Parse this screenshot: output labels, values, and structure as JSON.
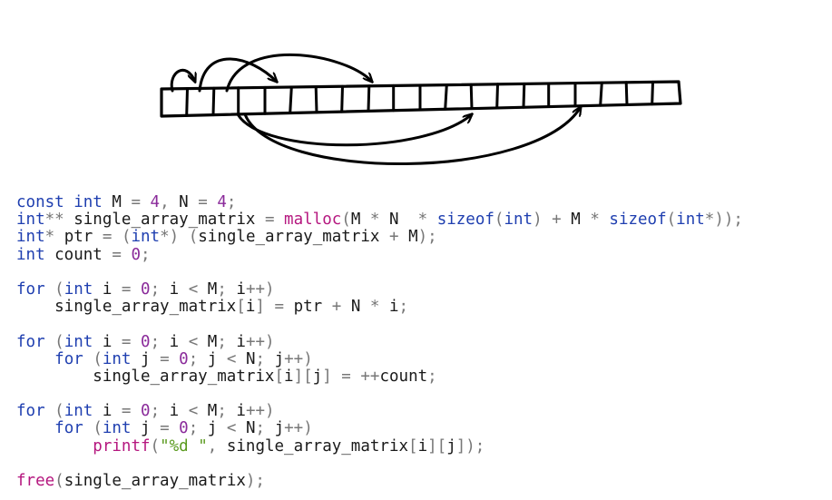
{
  "diagram": {
    "cell_count": 20,
    "pointer_cells": 4
  },
  "code_lines": [
    [
      [
        "kw",
        "const int"
      ],
      [
        "id",
        " M "
      ],
      [
        "op",
        "="
      ],
      [
        "id",
        " "
      ],
      [
        "num",
        "4"
      ],
      [
        "op",
        ","
      ],
      [
        "id",
        " N "
      ],
      [
        "op",
        "="
      ],
      [
        "id",
        " "
      ],
      [
        "num",
        "4"
      ],
      [
        "op",
        ";"
      ]
    ],
    [
      [
        "kw",
        "int"
      ],
      [
        "op",
        "**"
      ],
      [
        "id",
        " single_array_matrix "
      ],
      [
        "op",
        "="
      ],
      [
        "id",
        " "
      ],
      [
        "fn",
        "malloc"
      ],
      [
        "op",
        "("
      ],
      [
        "id",
        "M "
      ],
      [
        "op",
        "*"
      ],
      [
        "id",
        " N  "
      ],
      [
        "op",
        "*"
      ],
      [
        "id",
        " "
      ],
      [
        "kw",
        "sizeof"
      ],
      [
        "op",
        "("
      ],
      [
        "kw",
        "int"
      ],
      [
        "op",
        ")"
      ],
      [
        "id",
        " "
      ],
      [
        "op",
        "+"
      ],
      [
        "id",
        " M "
      ],
      [
        "op",
        "*"
      ],
      [
        "id",
        " "
      ],
      [
        "kw",
        "sizeof"
      ],
      [
        "op",
        "("
      ],
      [
        "kw",
        "int"
      ],
      [
        "op",
        "*"
      ],
      [
        "op",
        "));"
      ]
    ],
    [
      [
        "kw",
        "int"
      ],
      [
        "op",
        "*"
      ],
      [
        "id",
        " ptr "
      ],
      [
        "op",
        "="
      ],
      [
        "id",
        " "
      ],
      [
        "op",
        "("
      ],
      [
        "kw",
        "int"
      ],
      [
        "op",
        "*)"
      ],
      [
        "id",
        " "
      ],
      [
        "op",
        "("
      ],
      [
        "id",
        "single_array_matrix "
      ],
      [
        "op",
        "+"
      ],
      [
        "id",
        " M"
      ],
      [
        "op",
        ");"
      ]
    ],
    [
      [
        "kw",
        "int"
      ],
      [
        "id",
        " count "
      ],
      [
        "op",
        "="
      ],
      [
        "id",
        " "
      ],
      [
        "num",
        "0"
      ],
      [
        "op",
        ";"
      ]
    ],
    [],
    [
      [
        "kw",
        "for"
      ],
      [
        "id",
        " "
      ],
      [
        "op",
        "("
      ],
      [
        "kw",
        "int"
      ],
      [
        "id",
        " i "
      ],
      [
        "op",
        "="
      ],
      [
        "id",
        " "
      ],
      [
        "num",
        "0"
      ],
      [
        "op",
        ";"
      ],
      [
        "id",
        " i "
      ],
      [
        "op",
        "<"
      ],
      [
        "id",
        " M"
      ],
      [
        "op",
        ";"
      ],
      [
        "id",
        " i"
      ],
      [
        "op",
        "++)"
      ]
    ],
    [
      [
        "id",
        "    single_array_matrix"
      ],
      [
        "op",
        "["
      ],
      [
        "id",
        "i"
      ],
      [
        "op",
        "]"
      ],
      [
        "id",
        " "
      ],
      [
        "op",
        "="
      ],
      [
        "id",
        " ptr "
      ],
      [
        "op",
        "+"
      ],
      [
        "id",
        " N "
      ],
      [
        "op",
        "*"
      ],
      [
        "id",
        " i"
      ],
      [
        "op",
        ";"
      ]
    ],
    [],
    [
      [
        "kw",
        "for"
      ],
      [
        "id",
        " "
      ],
      [
        "op",
        "("
      ],
      [
        "kw",
        "int"
      ],
      [
        "id",
        " i "
      ],
      [
        "op",
        "="
      ],
      [
        "id",
        " "
      ],
      [
        "num",
        "0"
      ],
      [
        "op",
        ";"
      ],
      [
        "id",
        " i "
      ],
      [
        "op",
        "<"
      ],
      [
        "id",
        " M"
      ],
      [
        "op",
        ";"
      ],
      [
        "id",
        " i"
      ],
      [
        "op",
        "++)"
      ]
    ],
    [
      [
        "id",
        "    "
      ],
      [
        "kw",
        "for"
      ],
      [
        "id",
        " "
      ],
      [
        "op",
        "("
      ],
      [
        "kw",
        "int"
      ],
      [
        "id",
        " j "
      ],
      [
        "op",
        "="
      ],
      [
        "id",
        " "
      ],
      [
        "num",
        "0"
      ],
      [
        "op",
        ";"
      ],
      [
        "id",
        " j "
      ],
      [
        "op",
        "<"
      ],
      [
        "id",
        " N"
      ],
      [
        "op",
        ";"
      ],
      [
        "id",
        " j"
      ],
      [
        "op",
        "++)"
      ]
    ],
    [
      [
        "id",
        "        single_array_matrix"
      ],
      [
        "op",
        "["
      ],
      [
        "id",
        "i"
      ],
      [
        "op",
        "]["
      ],
      [
        "id",
        "j"
      ],
      [
        "op",
        "]"
      ],
      [
        "id",
        " "
      ],
      [
        "op",
        "="
      ],
      [
        "id",
        " "
      ],
      [
        "op",
        "++"
      ],
      [
        "id",
        "count"
      ],
      [
        "op",
        ";"
      ]
    ],
    [],
    [
      [
        "kw",
        "for"
      ],
      [
        "id",
        " "
      ],
      [
        "op",
        "("
      ],
      [
        "kw",
        "int"
      ],
      [
        "id",
        " i "
      ],
      [
        "op",
        "="
      ],
      [
        "id",
        " "
      ],
      [
        "num",
        "0"
      ],
      [
        "op",
        ";"
      ],
      [
        "id",
        " i "
      ],
      [
        "op",
        "<"
      ],
      [
        "id",
        " M"
      ],
      [
        "op",
        ";"
      ],
      [
        "id",
        " i"
      ],
      [
        "op",
        "++)"
      ]
    ],
    [
      [
        "id",
        "    "
      ],
      [
        "kw",
        "for"
      ],
      [
        "id",
        " "
      ],
      [
        "op",
        "("
      ],
      [
        "kw",
        "int"
      ],
      [
        "id",
        " j "
      ],
      [
        "op",
        "="
      ],
      [
        "id",
        " "
      ],
      [
        "num",
        "0"
      ],
      [
        "op",
        ";"
      ],
      [
        "id",
        " j "
      ],
      [
        "op",
        "<"
      ],
      [
        "id",
        " N"
      ],
      [
        "op",
        ";"
      ],
      [
        "id",
        " j"
      ],
      [
        "op",
        "++)"
      ]
    ],
    [
      [
        "id",
        "        "
      ],
      [
        "fn",
        "printf"
      ],
      [
        "op",
        "("
      ],
      [
        "str",
        "\"%d \""
      ],
      [
        "op",
        ","
      ],
      [
        "id",
        " single_array_matrix"
      ],
      [
        "op",
        "["
      ],
      [
        "id",
        "i"
      ],
      [
        "op",
        "]["
      ],
      [
        "id",
        "j"
      ],
      [
        "op",
        "]);"
      ]
    ],
    [],
    [
      [
        "fn",
        "free"
      ],
      [
        "op",
        "("
      ],
      [
        "id",
        "single_array_matrix"
      ],
      [
        "op",
        ");"
      ]
    ]
  ]
}
